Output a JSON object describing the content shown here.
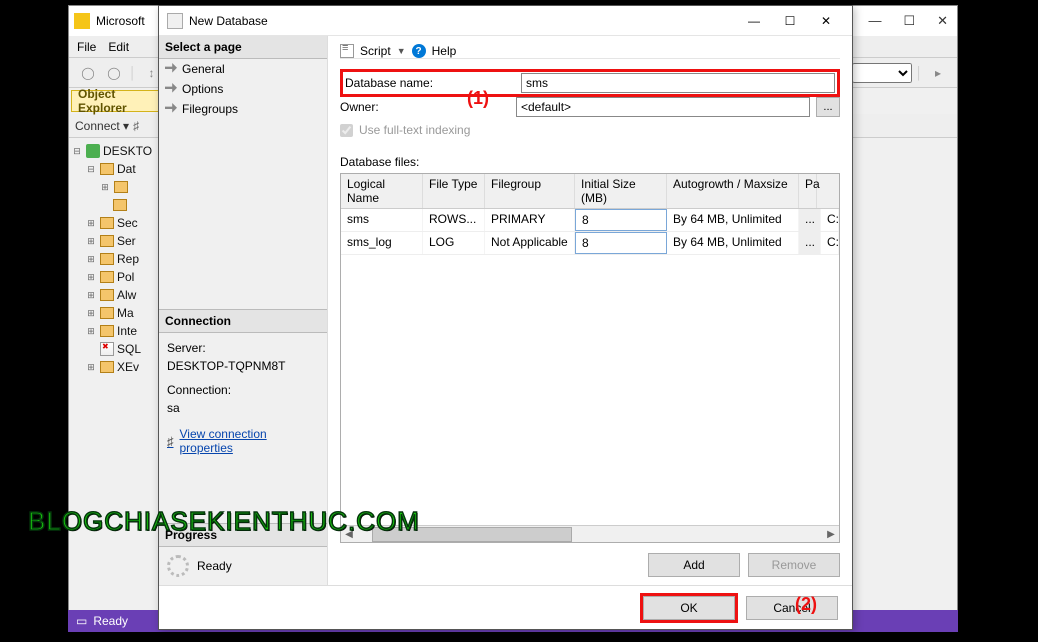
{
  "main": {
    "title": "Microsoft",
    "menus": {
      "file": "File",
      "edit": "Edit"
    },
    "obj_explorer_title": "Object Explorer",
    "connect": "Connect",
    "tree": {
      "server": "DESKTO",
      "items": [
        "Dat",
        "Sec",
        "Ser",
        "Rep",
        "Pol",
        "Alw",
        "Ma",
        "Inte",
        "SQL",
        "XEv"
      ]
    }
  },
  "status": {
    "ready": "Ready"
  },
  "dialog": {
    "title": "New Database",
    "sidebar": {
      "select_page": "Select a page",
      "pages": [
        "General",
        "Options",
        "Filegroups"
      ],
      "connection_header": "Connection",
      "server_label": "Server:",
      "server_value": "DESKTOP-TQPNM8T",
      "connection_label": "Connection:",
      "connection_value": "sa",
      "view_props": "View connection properties",
      "progress_header": "Progress",
      "ready": "Ready"
    },
    "toolbar": {
      "script": "Script",
      "help": "Help"
    },
    "form": {
      "dbname_label": "Database name:",
      "dbname_value": "sms",
      "owner_label": "Owner:",
      "owner_value": "<default>",
      "fulltext_label": "Use full-text indexing",
      "files_label": "Database files:"
    },
    "grid": {
      "headers": {
        "ln": "Logical Name",
        "ft": "File Type",
        "fg": "Filegroup",
        "is": "Initial Size (MB)",
        "ag": "Autogrowth / Maxsize",
        "path": "Pa"
      },
      "rows": [
        {
          "ln": "sms",
          "ft": "ROWS...",
          "fg": "PRIMARY",
          "is": "8",
          "ag": "By 64 MB, Unlimited",
          "path": "C:"
        },
        {
          "ln": "sms_log",
          "ft": "LOG",
          "fg": "Not Applicable",
          "is": "8",
          "ag": "By 64 MB, Unlimited",
          "path": "C:"
        }
      ]
    },
    "buttons": {
      "add": "Add",
      "remove": "Remove",
      "ok": "OK",
      "cancel": "Cancel"
    }
  },
  "annotations": {
    "one": "(1)",
    "two": "(2)"
  },
  "watermark": "BLOGCHIASEKIENTHUC.COM"
}
